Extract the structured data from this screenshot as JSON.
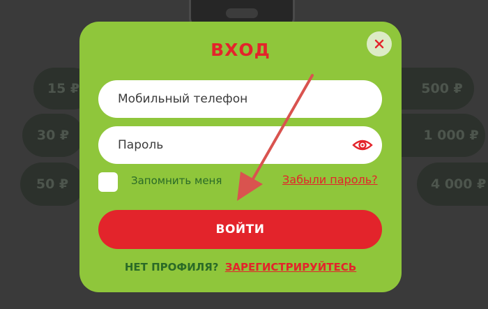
{
  "background": {
    "amount_chips": [
      "15 ₽",
      "30 ₽",
      "50 ₽",
      "500 ₽",
      "1 000 ₽",
      "4 000 ₽"
    ]
  },
  "modal": {
    "title": "ВХОД",
    "close_icon": "close-icon",
    "phone_placeholder": "Мобильный телефон",
    "password_placeholder": "Пароль",
    "eye_icon": "eye-icon",
    "remember_label": "Запомнить меня",
    "forgot_link": "Забыли пароль?",
    "login_button": "ВОЙТИ",
    "no_profile_text": "НЕТ ПРОФИЛЯ?",
    "register_link": "ЗАРЕГИСТРИРУЙТЕСЬ"
  },
  "colors": {
    "modal_bg": "#8fc63b",
    "accent_red": "#e3242b",
    "dark_green_text": "#2a6a27",
    "page_bg": "#3a3a3a"
  }
}
